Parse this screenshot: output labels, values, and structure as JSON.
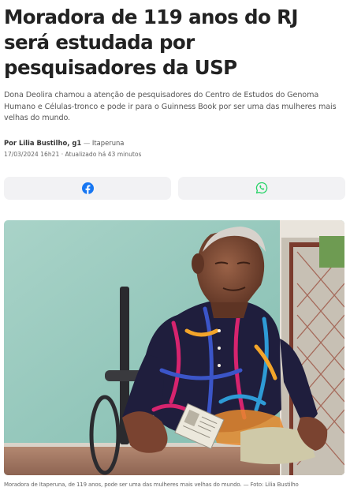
{
  "article": {
    "headline": "Moradora de 119 anos do RJ será estudada por pesquisadores da USP",
    "subtitle": "Dona Deolira chamou a atenção de pesquisadores do Centro de Estudos do Genoma Humano e Células-tronco e pode ir para o Guinness Book por ser uma das mulheres mais velhas do mundo.",
    "byline": {
      "author": "Por Lilia Bustilho, g1",
      "separator": "—",
      "location": "Itaperuna"
    },
    "dateline": "17/03/2024 16h21 · Atualizado há 43 minutos"
  },
  "share": {
    "facebook_icon": "facebook-icon",
    "whatsapp_icon": "whatsapp-icon",
    "facebook_color": "#1877f2",
    "whatsapp_color": "#25d366"
  },
  "photo": {
    "caption": "Moradora de Itaperuna, de 119 anos, pode ser uma das mulheres mais velhas do mundo. — Foto: Lilia Bustilho"
  }
}
